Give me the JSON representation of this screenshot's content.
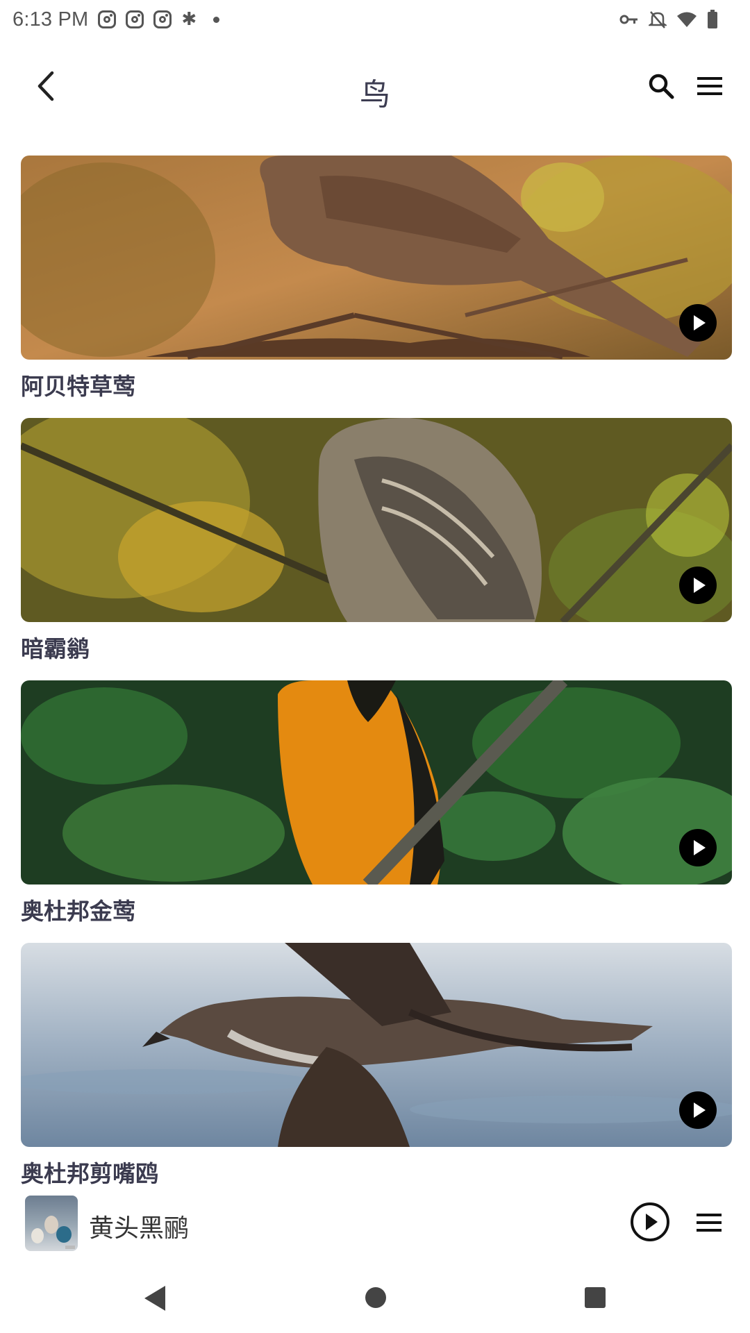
{
  "status_bar": {
    "time": "6:13 PM",
    "icons": [
      "instagram-icon",
      "instagram-icon",
      "instagram-icon",
      "bluetooth-icon",
      "notification-dot-icon",
      "vpn-key-icon",
      "mute-icon",
      "wifi-icon",
      "battery-icon"
    ]
  },
  "app_bar": {
    "title": "鸟",
    "back_icon": "back-arrow-icon",
    "search_icon": "search-icon",
    "menu_icon": "menu-icon"
  },
  "cards": [
    {
      "title": "阿贝特草莺",
      "scene": "sunset-brown-bird"
    },
    {
      "title": "暗霸鹟",
      "scene": "gray-bird-yellow-leaves"
    },
    {
      "title": "奥杜邦金莺",
      "scene": "orange-bird-green-leaves"
    },
    {
      "title": "奥杜邦剪嘴鸥",
      "scene": "seabird-over-water"
    }
  ],
  "mini_player": {
    "title": "黄头黑鹂",
    "play_icon": "play-circle-icon",
    "queue_icon": "queue-icon"
  },
  "nav_bar": {
    "back": "nav-back-icon",
    "home": "nav-home-icon",
    "recent": "nav-recents-icon"
  }
}
